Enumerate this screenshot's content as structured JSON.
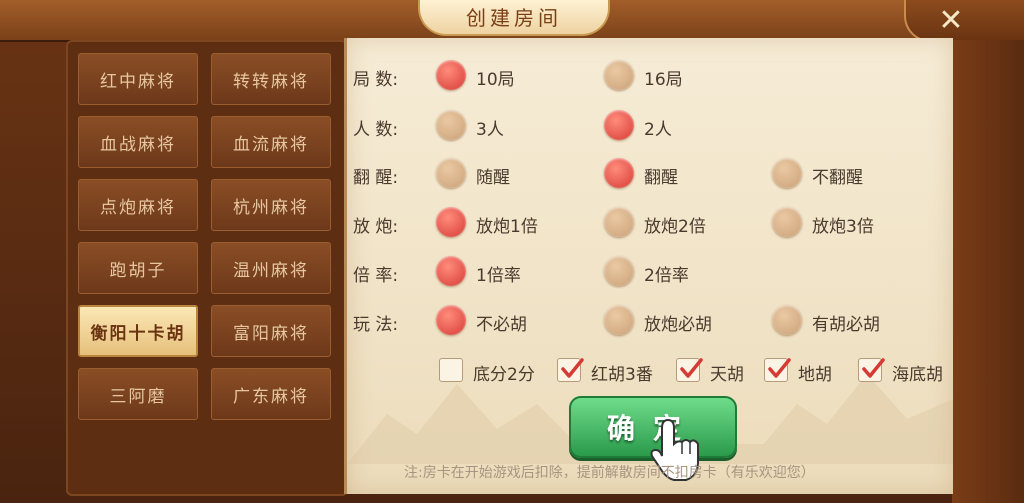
{
  "window": {
    "title": "创建房间",
    "close_label": "✕"
  },
  "sidebar": {
    "items": [
      {
        "label": "红中麻将",
        "active": false
      },
      {
        "label": "转转麻将",
        "active": false
      },
      {
        "label": "血战麻将",
        "active": false
      },
      {
        "label": "血流麻将",
        "active": false
      },
      {
        "label": "点炮麻将",
        "active": false
      },
      {
        "label": "杭州麻将",
        "active": false
      },
      {
        "label": "跑胡子",
        "active": false
      },
      {
        "label": "温州麻将",
        "active": false
      },
      {
        "label": "衡阳十卡胡",
        "active": true
      },
      {
        "label": "富阳麻将",
        "active": false
      },
      {
        "label": "三阿磨",
        "active": false
      },
      {
        "label": "广东麻将",
        "active": false
      }
    ]
  },
  "options": {
    "rounds": {
      "label": "局  数:",
      "choices": [
        "10局",
        "16局"
      ],
      "selected": "10局"
    },
    "players": {
      "label": "人  数:",
      "choices": [
        "3人",
        "2人"
      ],
      "selected": "2人"
    },
    "wake": {
      "label": "翻  醒:",
      "choices": [
        "随醒",
        "翻醒",
        "不翻醒"
      ],
      "selected": "翻醒"
    },
    "discard": {
      "label": "放  炮:",
      "choices": [
        "放炮1倍",
        "放炮2倍",
        "放炮3倍"
      ],
      "selected": "放炮1倍"
    },
    "multiplier": {
      "label": "倍  率:",
      "choices": [
        "1倍率",
        "2倍率"
      ],
      "selected": "1倍率"
    },
    "play": {
      "label": "玩  法:",
      "choices": [
        "不必胡",
        "放炮必胡",
        "有胡必胡"
      ],
      "selected": "不必胡"
    }
  },
  "extras": [
    {
      "label": "底分2分",
      "checked": false
    },
    {
      "label": "红胡3番",
      "checked": true
    },
    {
      "label": "天胡",
      "checked": true
    },
    {
      "label": "地胡",
      "checked": true
    },
    {
      "label": "海底胡",
      "checked": true
    }
  ],
  "confirm_label": "确定",
  "note": "注:房卡在开始游戏后扣除，提前解散房间不扣房卡（有乐欢迎您）",
  "colors": {
    "selected_radio": "#d63a34",
    "unselected_radio": "#caa077",
    "confirm_green": "#2a9a4b",
    "paper": "#f3e7cf",
    "wood": "#7a4119"
  }
}
